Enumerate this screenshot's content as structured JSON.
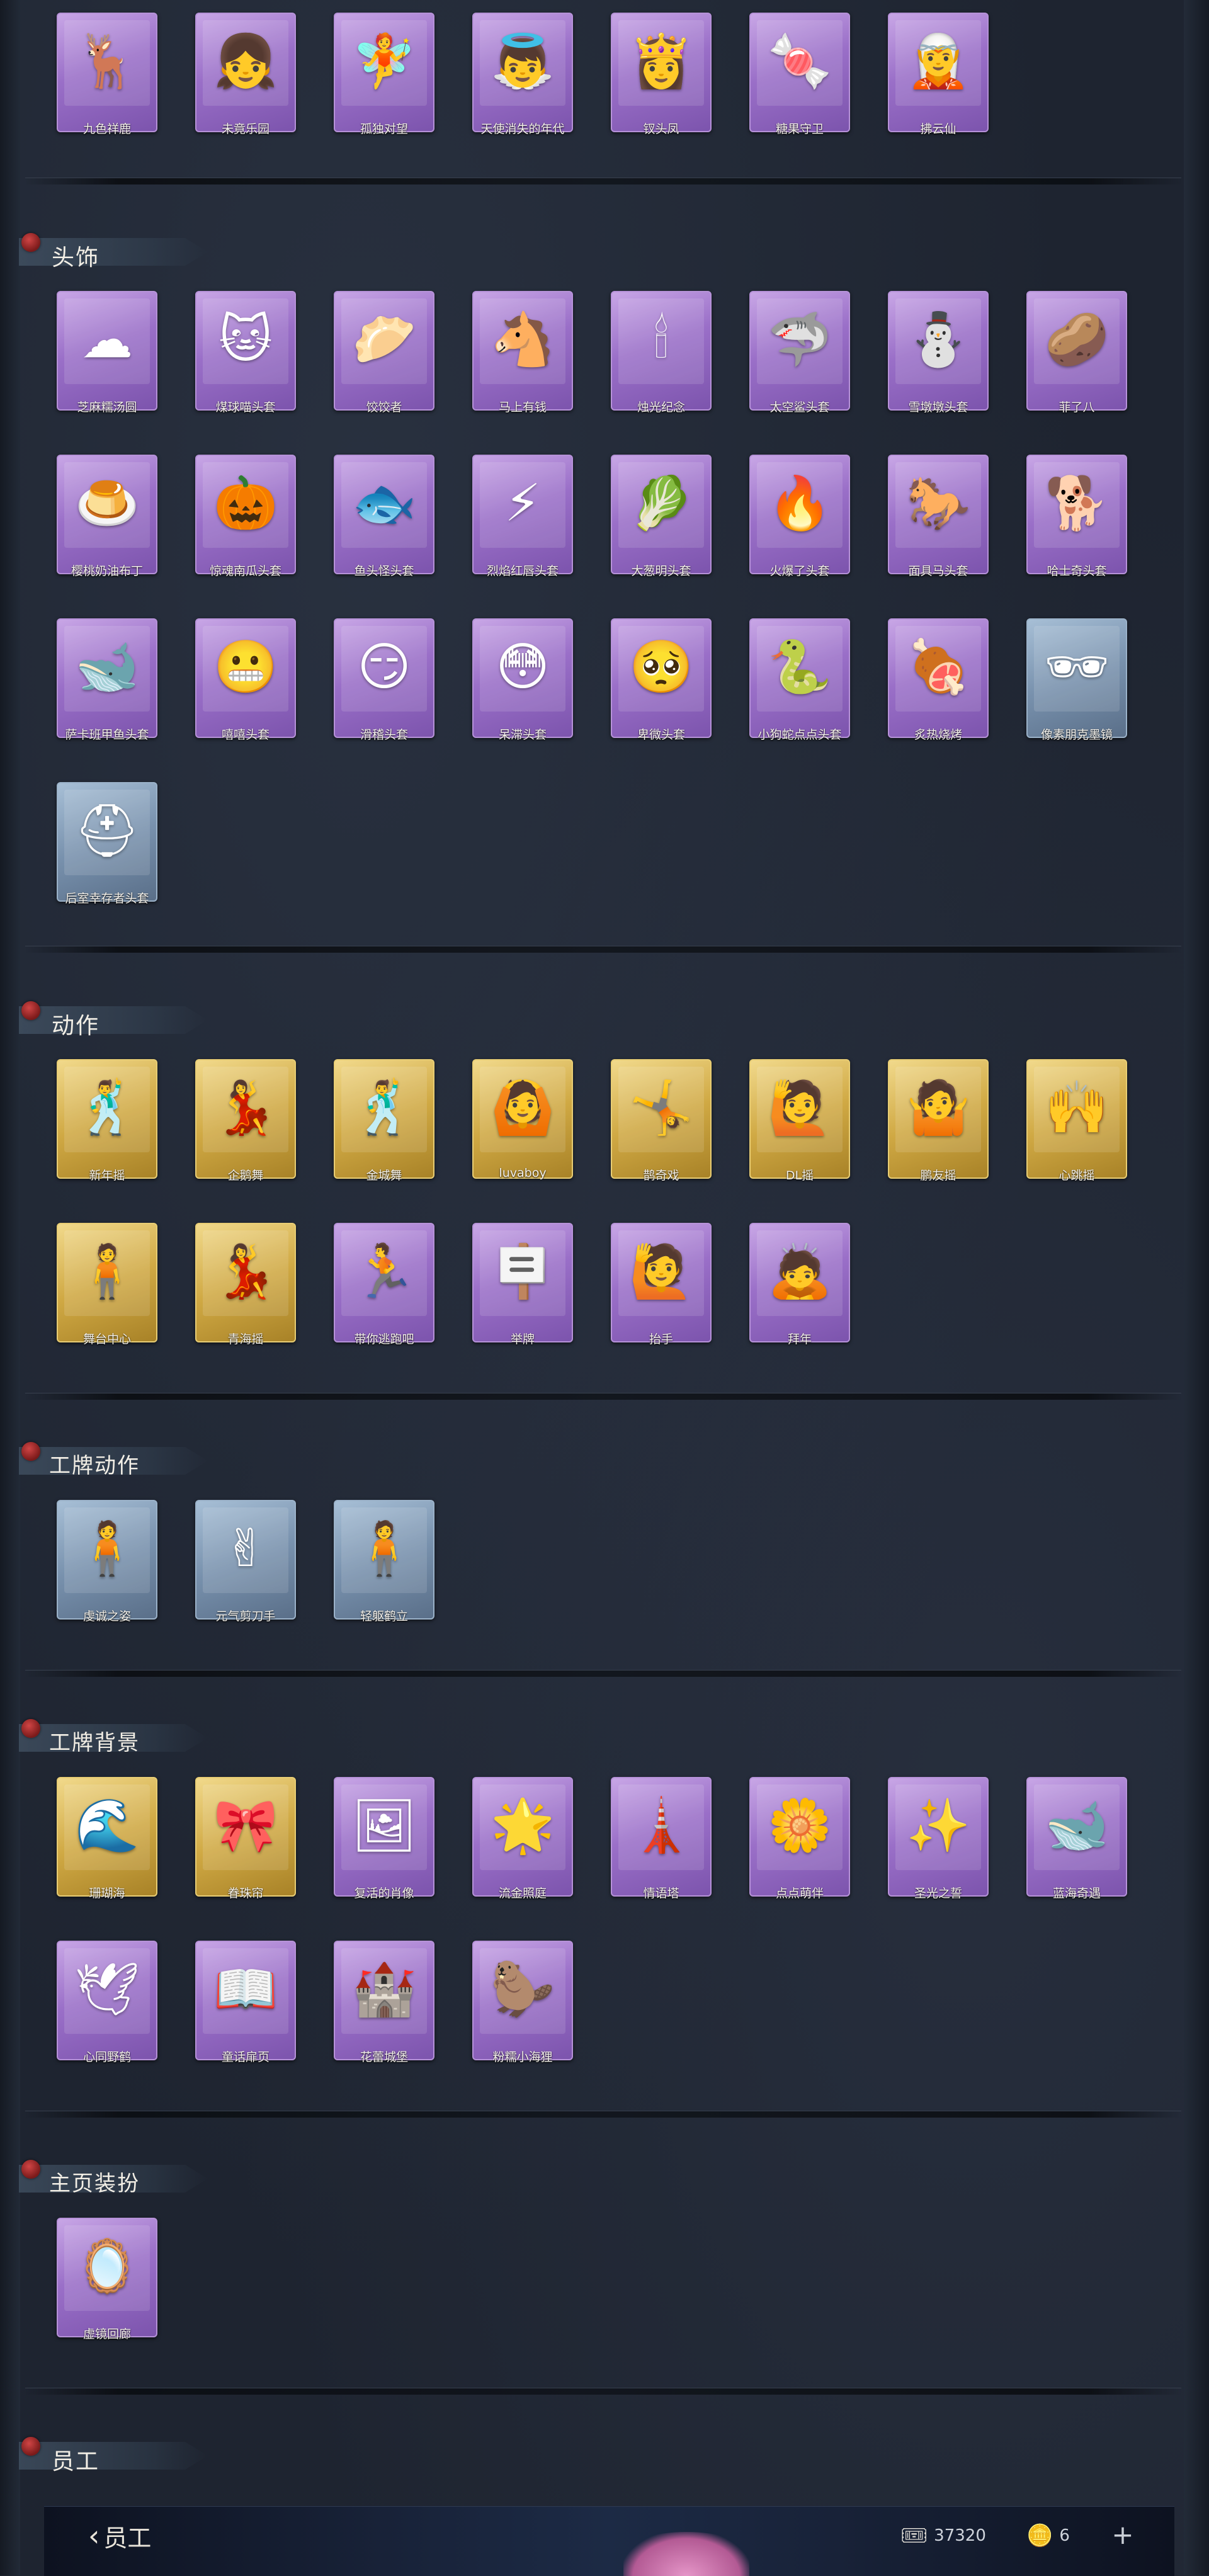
{
  "sections": {
    "top_row": {
      "items": [
        {
          "label": "九色祥鹿",
          "icon": "deer-icon",
          "glyph": "🦌",
          "color": "purple"
        },
        {
          "label": "未竟乐园",
          "icon": "doll-icon",
          "glyph": "👧",
          "color": "purple"
        },
        {
          "label": "孤独对望",
          "icon": "figure-icon",
          "glyph": "🧚",
          "color": "purple"
        },
        {
          "label": "天使消失的年代",
          "icon": "angel-icon",
          "glyph": "👼",
          "color": "purple"
        },
        {
          "label": "钗头凤",
          "icon": "lady-icon",
          "glyph": "👸",
          "color": "purple"
        },
        {
          "label": "糖果守卫",
          "icon": "candy-icon",
          "glyph": "🍬",
          "color": "purple"
        },
        {
          "label": "拂云仙",
          "icon": "cloud-fairy-icon",
          "glyph": "🧝",
          "color": "purple"
        }
      ]
    },
    "headwear": {
      "title": "头饰",
      "items": [
        {
          "label": "芝麻糯汤圆",
          "icon": "dumpling-icon",
          "glyph": "☁",
          "color": "purple"
        },
        {
          "label": "煤球喵头套",
          "icon": "cat-icon",
          "glyph": "🐱",
          "color": "purple"
        },
        {
          "label": "饺饺者",
          "icon": "jiaozi-icon",
          "glyph": "🥟",
          "color": "purple"
        },
        {
          "label": "马上有钱",
          "icon": "horse-icon",
          "glyph": "🐴",
          "color": "purple"
        },
        {
          "label": "烛光纪念",
          "icon": "candle-icon",
          "glyph": "🕯",
          "color": "purple"
        },
        {
          "label": "太空鲨头套",
          "icon": "shark-icon",
          "glyph": "🦈",
          "color": "purple"
        },
        {
          "label": "雪墩墩头套",
          "icon": "snowman-icon",
          "glyph": "⛄",
          "color": "purple"
        },
        {
          "label": "菲了八",
          "icon": "radish-icon",
          "glyph": "🥔",
          "color": "purple"
        },
        {
          "label": "樱桃奶油布丁",
          "icon": "pudding-icon",
          "glyph": "🍮",
          "color": "purple"
        },
        {
          "label": "惊魂南瓜头套",
          "icon": "pumpkin-icon",
          "glyph": "🎃",
          "color": "purple"
        },
        {
          "label": "鱼头怪头套",
          "icon": "fish-head-icon",
          "glyph": "🐟",
          "color": "purple"
        },
        {
          "label": "烈焰红唇头套",
          "icon": "pikachu-icon",
          "glyph": "⚡",
          "color": "purple"
        },
        {
          "label": "大葱明头套",
          "icon": "leek-icon",
          "glyph": "🥬",
          "color": "purple"
        },
        {
          "label": "火爆了头套",
          "icon": "fire-icon",
          "glyph": "🔥",
          "color": "purple"
        },
        {
          "label": "面具马头套",
          "icon": "horse-mask-icon",
          "glyph": "🐎",
          "color": "purple"
        },
        {
          "label": "哈士奇头套",
          "icon": "husky-icon",
          "glyph": "🐕",
          "color": "purple"
        },
        {
          "label": "萨卡班甲鱼头套",
          "icon": "fish-icon",
          "glyph": "🐋",
          "color": "purple"
        },
        {
          "label": "嘻嘻头套",
          "icon": "grin-icon",
          "glyph": "😬",
          "color": "purple"
        },
        {
          "label": "滑稽头套",
          "icon": "smirk-icon",
          "glyph": "😏",
          "color": "purple"
        },
        {
          "label": "呆滞头套",
          "icon": "stunned-icon",
          "glyph": "😳",
          "color": "purple"
        },
        {
          "label": "卑微头套",
          "icon": "humble-icon",
          "glyph": "🥺",
          "color": "purple"
        },
        {
          "label": "小狗蛇点点头套",
          "icon": "snake-icon",
          "glyph": "🐍",
          "color": "purple"
        },
        {
          "label": "炙热烧烤",
          "icon": "bbq-icon",
          "glyph": "🍖",
          "color": "purple"
        },
        {
          "label": "像素朋克墨镜",
          "icon": "sunglasses-icon",
          "glyph": "🕶",
          "color": "blue"
        },
        {
          "label": "后室幸存者头套",
          "icon": "helmet-icon",
          "glyph": "⛑",
          "color": "blue"
        }
      ]
    },
    "actions": {
      "title": "动作",
      "items": [
        {
          "label": "新年摇",
          "icon": "dance-pose-icon",
          "glyph": "🕺",
          "color": "gold"
        },
        {
          "label": "企鹅舞",
          "icon": "dance-pose-icon",
          "glyph": "💃",
          "color": "gold"
        },
        {
          "label": "金城舞",
          "icon": "dance-pose-icon",
          "glyph": "🕺",
          "color": "gold"
        },
        {
          "label": "luvaboy",
          "icon": "dance-pose-icon",
          "glyph": "🙆",
          "color": "gold"
        },
        {
          "label": "鹊奇戏",
          "icon": "dance-pose-icon",
          "glyph": "🤸",
          "color": "gold"
        },
        {
          "label": "DL摇",
          "icon": "dance-pose-icon",
          "glyph": "🙋",
          "color": "gold"
        },
        {
          "label": "鹏友摇",
          "icon": "dance-pose-icon",
          "glyph": "🤷",
          "color": "gold"
        },
        {
          "label": "心跳摇",
          "icon": "dance-pose-icon",
          "glyph": "🙌",
          "color": "gold"
        },
        {
          "label": "舞台中心",
          "icon": "dance-pose-icon",
          "glyph": "🧍",
          "color": "gold"
        },
        {
          "label": "青海摇",
          "icon": "dance-pose-icon",
          "glyph": "💃",
          "color": "gold"
        },
        {
          "label": "带你逃跑吧",
          "icon": "run-pose-icon",
          "glyph": "🏃",
          "color": "purple"
        },
        {
          "label": "举牌",
          "icon": "sign-pose-icon",
          "glyph": "🪧",
          "color": "purple"
        },
        {
          "label": "抬手",
          "icon": "raise-hand-pose-icon",
          "glyph": "🙋",
          "color": "purple"
        },
        {
          "label": "拜年",
          "icon": "bow-pose-icon",
          "glyph": "🙇",
          "color": "purple"
        }
      ]
    },
    "badge_actions": {
      "title": "工牌动作",
      "items": [
        {
          "label": "虔诚之姿",
          "icon": "silhouette-icon",
          "glyph": "🧍",
          "color": "blue"
        },
        {
          "label": "元气剪刀手",
          "icon": "silhouette-icon",
          "glyph": "✌",
          "color": "blue"
        },
        {
          "label": "轻躯鹤立",
          "icon": "silhouette-icon",
          "glyph": "🧍",
          "color": "blue"
        }
      ]
    },
    "badge_backgrounds": {
      "title": "工牌背景",
      "items": [
        {
          "label": "珊瑚海",
          "icon": "card-bg-icon",
          "glyph": "🌊",
          "color": "gold"
        },
        {
          "label": "眷珠帘",
          "icon": "card-bg-icon",
          "glyph": "🎀",
          "color": "gold"
        },
        {
          "label": "复活的肖像",
          "icon": "card-bg-icon",
          "glyph": "🖼",
          "color": "purple"
        },
        {
          "label": "流金照庭",
          "icon": "card-bg-icon",
          "glyph": "🌟",
          "color": "purple"
        },
        {
          "label": "情语塔",
          "icon": "card-bg-icon",
          "glyph": "🗼",
          "color": "purple"
        },
        {
          "label": "点点萌伴",
          "icon": "card-bg-icon",
          "glyph": "🌼",
          "color": "purple"
        },
        {
          "label": "圣光之誓",
          "icon": "card-bg-icon",
          "glyph": "✨",
          "color": "purple"
        },
        {
          "label": "蓝海奇遇",
          "icon": "card-bg-icon",
          "glyph": "🐋",
          "color": "purple"
        },
        {
          "label": "心同野鹤",
          "icon": "card-bg-icon",
          "glyph": "🕊",
          "color": "purple"
        },
        {
          "label": "童话扉页",
          "icon": "card-bg-icon",
          "glyph": "📖",
          "color": "purple"
        },
        {
          "label": "花蕾城堡",
          "icon": "card-bg-icon",
          "glyph": "🏰",
          "color": "purple"
        },
        {
          "label": "粉糯小海狸",
          "icon": "card-bg-icon",
          "glyph": "🦫",
          "color": "purple"
        }
      ]
    },
    "homepage_decor": {
      "title": "主页装扮",
      "items": [
        {
          "label": "虚镜回廊",
          "icon": "decor-icon",
          "glyph": "🪞",
          "color": "purple"
        }
      ]
    },
    "staff": {
      "title": "员工"
    }
  },
  "bottom_bar": {
    "back_label": "员工",
    "currency_1": {
      "icon": "ticket-icon",
      "glyph": "🎟",
      "value": "37320"
    },
    "currency_2": {
      "icon": "gold-icon",
      "glyph": "🪙",
      "value": "6"
    },
    "plus_label": "+"
  }
}
